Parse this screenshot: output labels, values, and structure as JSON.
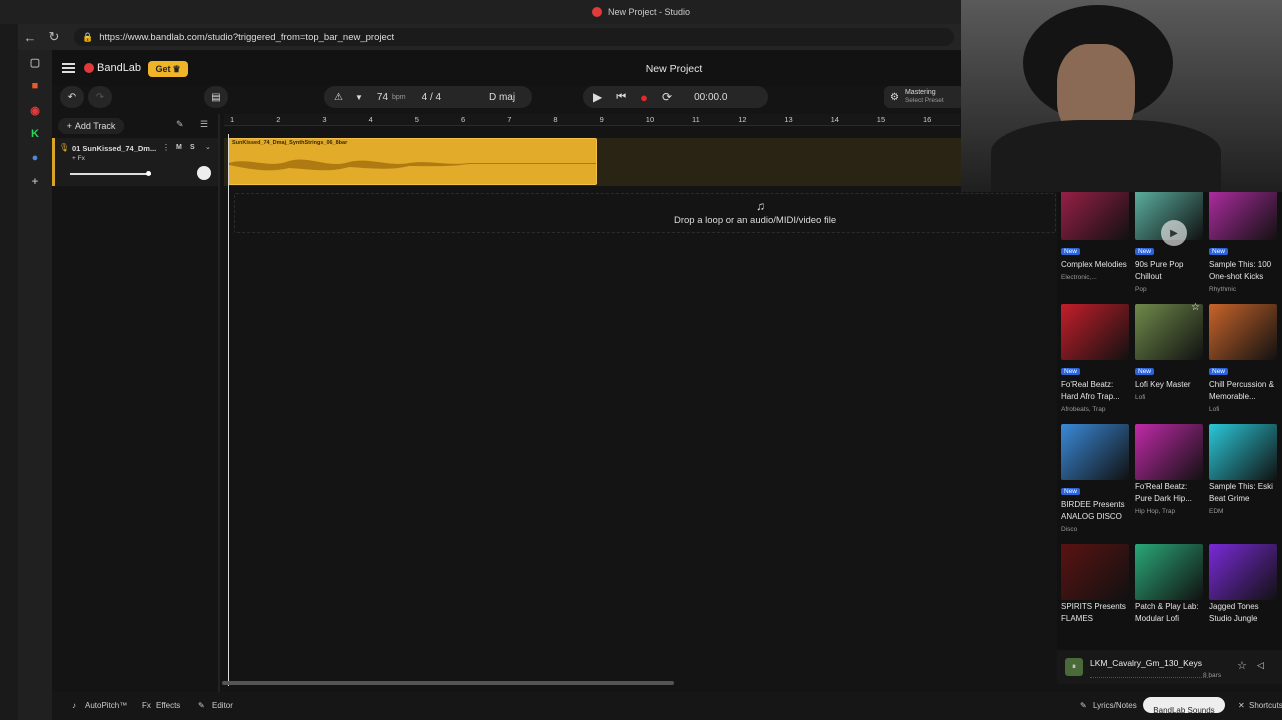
{
  "window": {
    "title": "New Project - Studio"
  },
  "browser": {
    "url": "https://www.bandlab.com/studio?triggered_from=top_bar_new_project"
  },
  "app": {
    "brand": "BandLab",
    "get_label": "Get",
    "project_title": "New Project",
    "tempo": "74",
    "tempo_unit": "bpm",
    "time_signature": "4 / 4",
    "key": "D maj",
    "time": "00:00.0",
    "mastering_label": "Mastering",
    "mastering_sub": "Select Preset"
  },
  "tracks": {
    "add_track_label": "Add Track",
    "items": [
      {
        "name": "01  SunKissed_74_Dm...",
        "fx": "+ Fx",
        "mute": "M",
        "solo": "S",
        "clip_name": "SunKissed_74_Dmaj_SynthStrings_06_8bar",
        "volume": 0.58
      }
    ]
  },
  "ruler": {
    "marks": [
      "1",
      "2",
      "3",
      "4",
      "5",
      "6",
      "7",
      "8",
      "9",
      "10",
      "11",
      "12",
      "13",
      "14",
      "15",
      "16"
    ]
  },
  "drop_zone": {
    "text": "Drop a loop or an audio/MIDI/video file"
  },
  "sounds_panel": {
    "cards": [
      {
        "title": "Complex Melodies",
        "genre": "Electronic,...",
        "badge": "New",
        "color": "#a0204a"
      },
      {
        "title": "90s Pure Pop Chillout",
        "genre": "Pop",
        "badge": "New",
        "color": "#5fb8a8"
      },
      {
        "title": "Sample This: 100 One-shot Kicks",
        "genre": "Rhythmic",
        "badge": "New",
        "color": "#b62da8"
      },
      {
        "title": "Fo'Real Beatz: Hard Afro Trap...",
        "genre": "Afrobeats, Trap",
        "badge": "New",
        "color": "#c41e2a"
      },
      {
        "title": "Lofi Key Master",
        "genre": "Lofi",
        "badge": "New",
        "color": "#6f8a4a"
      },
      {
        "title": "Chill Percussion & Memorable...",
        "genre": "Lofi",
        "badge": "New",
        "color": "#c8642a"
      },
      {
        "title": "BIRDEE Presents ANALOG DISCO",
        "genre": "Disco",
        "badge": "New",
        "color": "#3a8ad8"
      },
      {
        "title": "Fo'Real Beatz: Pure Dark Hip...",
        "genre": "Hip Hop, Trap",
        "badge": "",
        "color": "#c02aa8"
      },
      {
        "title": "Sample This: Eski Beat Grime",
        "genre": "EDM",
        "badge": "",
        "color": "#2ac8d8"
      },
      {
        "title": "SPIRITS Presents FLAMES",
        "genre": "",
        "badge": "",
        "color": "#5a1212"
      },
      {
        "title": "Patch & Play Lab: Modular Lofi",
        "genre": "",
        "badge": "",
        "color": "#2aa878"
      },
      {
        "title": "Jagged Tones Studio Jungle",
        "genre": "",
        "badge": "",
        "color": "#7a2ad8"
      }
    ],
    "now_playing": {
      "title": "LKM_Cavalry_Gm_130_Keys",
      "meta": "8 bars"
    }
  },
  "bottom": {
    "autopitch": "AutoPitch™",
    "effects": "Effects",
    "editor": "Editor",
    "lyrics": "Lyrics/Notes",
    "sounds": "BandLab Sounds",
    "shortcuts": "Shortcuts"
  }
}
